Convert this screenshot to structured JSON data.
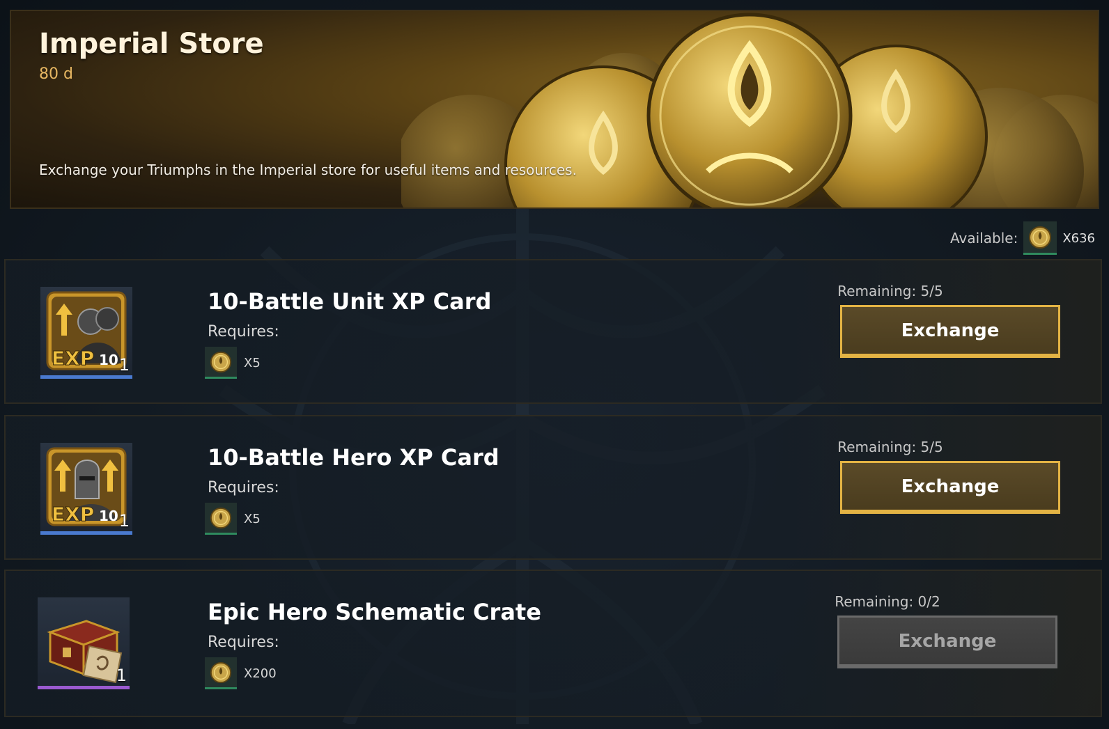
{
  "banner": {
    "title": "Imperial Store",
    "timer": "80 d",
    "description": "Exchange your Triumphs in the Imperial store for useful items and resources."
  },
  "available": {
    "label": "Available:",
    "count": "X636",
    "icon": "triumph-coin-icon"
  },
  "items": [
    {
      "name": "10-Battle Unit XP Card",
      "requires_label": "Requires:",
      "cost": "X5",
      "cost_icon": "triumph-coin-icon",
      "icon": "unit-xp-card-icon",
      "icon_text": "EXP",
      "icon_number": "10",
      "quantity": "1",
      "rarity_color": "#4a7ad0",
      "remaining": "Remaining: 5/5",
      "button_label": "Exchange",
      "button_enabled": true
    },
    {
      "name": "10-Battle Hero XP Card",
      "requires_label": "Requires:",
      "cost": "X5",
      "cost_icon": "triumph-coin-icon",
      "icon": "hero-xp-card-icon",
      "icon_text": "EXP",
      "icon_number": "10",
      "quantity": "1",
      "rarity_color": "#4a7ad0",
      "remaining": "Remaining: 5/5",
      "button_label": "Exchange",
      "button_enabled": true
    },
    {
      "name": "Epic Hero Schematic Crate",
      "requires_label": "Requires:",
      "cost": "X200",
      "cost_icon": "triumph-coin-icon",
      "icon": "schematic-crate-icon",
      "quantity": "1",
      "rarity_color": "#9a5ad0",
      "remaining": "Remaining: 0/2",
      "button_label": "Exchange",
      "button_enabled": false
    }
  ]
}
